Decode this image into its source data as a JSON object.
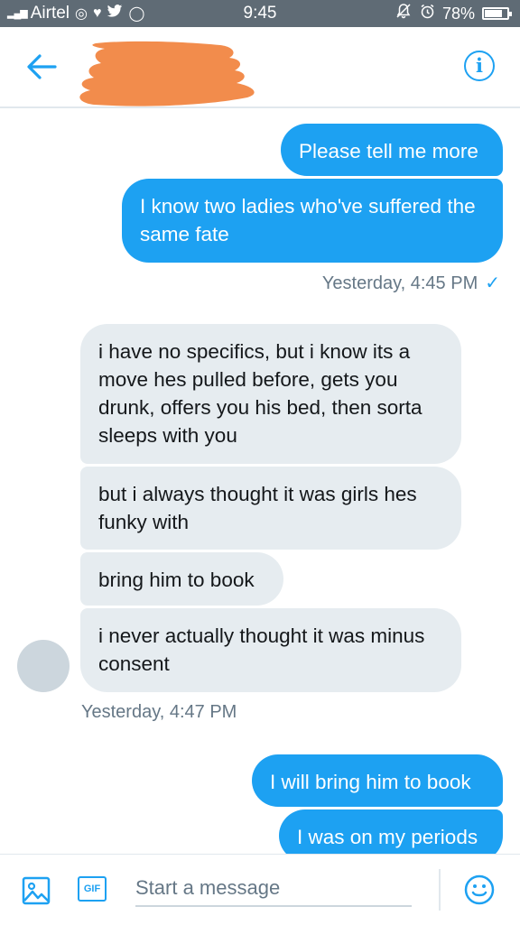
{
  "status_bar": {
    "carrier": "Airtel",
    "time": "9:45",
    "battery": "78%",
    "battery_level": 0.78
  },
  "header": {
    "back_icon": "arrow-left-icon",
    "info_icon": "info-icon",
    "info_glyph": "i"
  },
  "messages": [
    {
      "direction": "outgoing",
      "text": "Please tell me more"
    },
    {
      "direction": "outgoing",
      "text": "I know two ladies who've suffered the same fate"
    },
    {
      "direction": "incoming",
      "text": "i have no specifics, but i know its a move hes pulled before, gets you drunk, offers you his bed, then sorta sleeps with you"
    },
    {
      "direction": "incoming",
      "text": "but i always thought it was girls hes funky with"
    },
    {
      "direction": "incoming",
      "text": "bring him to book"
    },
    {
      "direction": "incoming",
      "text": "i never actually thought it was minus consent"
    },
    {
      "direction": "outgoing",
      "text": "I will bring him to book"
    },
    {
      "direction": "outgoing",
      "text": "I was on my periods"
    }
  ],
  "timestamps": {
    "outgoing_1": "Yesterday, 4:45 PM",
    "outgoing_1_check": "✓",
    "incoming_1": "Yesterday, 4:47 PM"
  },
  "composer": {
    "placeholder": "Start a message",
    "value": "",
    "gif_label": "GIF",
    "image_icon": "image-icon",
    "emoji_icon": "emoji-icon"
  },
  "colors": {
    "accent": "#1da1f2",
    "incoming_bubble": "#e6ecf0",
    "status_bar": "#5f6b75"
  }
}
